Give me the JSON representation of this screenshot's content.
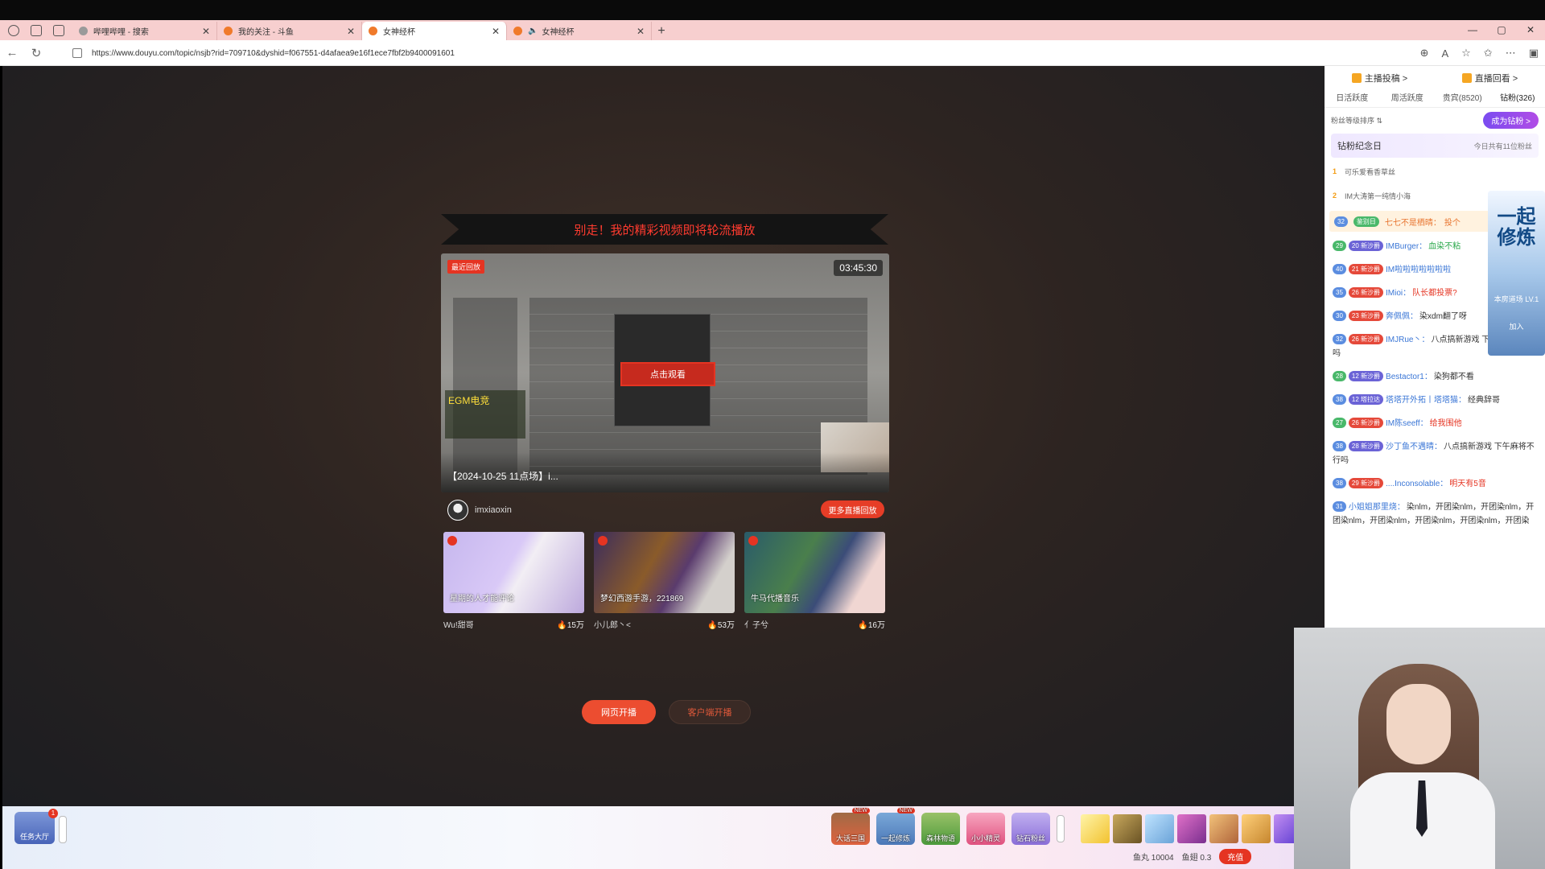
{
  "browser": {
    "tabs": [
      {
        "title": "哔哩哔哩 - 搜索",
        "active": false
      },
      {
        "title": "我的关注 - 斗鱼",
        "active": false
      },
      {
        "title": "女神经杯",
        "active": true
      },
      {
        "title": "女神经杯",
        "active": false,
        "audio": true
      }
    ],
    "new_tab_label": "+",
    "url": "https://www.douyu.com/topic/nsjb?rid=709710&dyshid=f067551-d4afaea9e16f1ece7fbf2b9400091601",
    "window_controls": [
      "—",
      "▢",
      "✕"
    ]
  },
  "player": {
    "banner": "别走！我的精彩视频即将轮流播放",
    "tag": "最近回放",
    "duration": "03:45:30",
    "watch_button": "点击观看",
    "caption": "【2024-10-25 11点场】i...",
    "logo_text": "EGM电竞"
  },
  "owner": {
    "name": "imxiaoxin",
    "more_button": "更多直播回放"
  },
  "cards": [
    {
      "subtitle": "星期的人才能评论",
      "streamer": "Wu!甜哥",
      "heat": "15万"
    },
    {
      "subtitle": "梦幻西游手游，221869",
      "streamer": "小儿郎丶<",
      "heat": "53万"
    },
    {
      "subtitle": "牛马代播音乐",
      "streamer": "亻子兮",
      "heat": "16万"
    }
  ],
  "cta": {
    "web_live": "网页开播",
    "client_live": "客户端开播"
  },
  "bottombar": {
    "task_hall": "任务大厅",
    "task_badge": "1",
    "games": [
      {
        "label": "大话三国",
        "new": "NEW"
      },
      {
        "label": "一起修炼",
        "new": "NEW"
      },
      {
        "label": "森林物语",
        "new": ""
      },
      {
        "label": "小小精灵",
        "new": ""
      },
      {
        "label": "钻石粉丝",
        "new": ""
      }
    ],
    "wallet": {
      "fish_ball": "鱼丸 10004",
      "fish_fin": "鱼翅 0.3",
      "recharge": "充值"
    }
  },
  "chat": {
    "top_links": [
      "主播投稿 >",
      "直播回看 >"
    ],
    "tabs": [
      "日活跃度",
      "周活跃度",
      "贵宾(8520)",
      "钻粉(326)"
    ],
    "sort_label": "粉丝等级排序 ⇅",
    "fan_button": "成为钻粉 >",
    "anniversary_title": "钻粉纪念日",
    "anniversary_note": "今日共有11位粉丝",
    "rank": [
      {
        "n": "1",
        "name": "可乐爱看香草丝"
      },
      {
        "n": "2",
        "name": "IM大涛第一纯情小海"
      }
    ],
    "pinned": {
      "lv": "32",
      "badge": "鉴别日",
      "name": "七七不是栖晴：",
      "text": "投个"
    },
    "messages": [
      {
        "lv": "29",
        "lv_color": "green",
        "badge": "20 新沙爵",
        "name": "IMBurger：",
        "text": "血染不粘",
        "text_color": "green"
      },
      {
        "lv": "40",
        "lv_color": "blue",
        "badge": "21 新沙爵",
        "name": "IM啦啦啦啦啦啦啦",
        "text": "",
        "text_color": "blue"
      },
      {
        "lv": "35",
        "lv_color": "blue",
        "badge": "26 新沙爵",
        "name": "IMioi：",
        "text": "队长都投票?",
        "text_color": "red"
      },
      {
        "lv": "30",
        "lv_color": "blue",
        "badge": "23 新沙爵",
        "name": "奔佩佩：",
        "text": "染xdm翻了呀",
        "text_color": ""
      },
      {
        "lv": "32",
        "lv_color": "blue",
        "badge": "26 新沙爵",
        "name": "IMJRue丶：",
        "text": "八点搞新游戏 下午麻将不行吗",
        "text_color": ""
      },
      {
        "lv": "28",
        "lv_color": "green",
        "badge": "12 新沙爵",
        "name": "Bestactor1：",
        "text": "染狗都不看",
        "text_color": ""
      },
      {
        "lv": "38",
        "lv_color": "blue",
        "badge": "12 塔拉达",
        "name": "塔塔开外拓丨塔塔猫：",
        "text": "经典辞哥",
        "text_color": ""
      },
      {
        "lv": "27",
        "lv_color": "green",
        "badge": "26 新沙爵",
        "name": "IM陈seeff：",
        "text": "给我围他",
        "text_color": "red"
      },
      {
        "lv": "38",
        "lv_color": "blue",
        "badge": "28 新沙爵",
        "name": "沙丁鱼不遇晴：",
        "text": "八点搞新游戏 下午麻将不行吗",
        "text_color": ""
      },
      {
        "lv": "38",
        "lv_color": "blue",
        "badge": "29 新沙爵",
        "name": "....Inconsolable：",
        "text": "明天有5音",
        "text_color": "red"
      },
      {
        "lv": "31",
        "lv_color": "blue",
        "badge": "",
        "name": "小姐姐那里烧：",
        "text": "染nlm，开团染nlm，开团染nlm，开团染nlm，开团染nlm，开团染nlm，开团染nlm，开团染",
        "text_color": ""
      }
    ],
    "side_ad": {
      "title": "一起修炼",
      "sub": "本房道场 LV.1",
      "join": "加入"
    }
  },
  "colors": {
    "accent": "#e53422",
    "tabstrip": "#f7cfcf",
    "page_bg": "#2d2421"
  }
}
